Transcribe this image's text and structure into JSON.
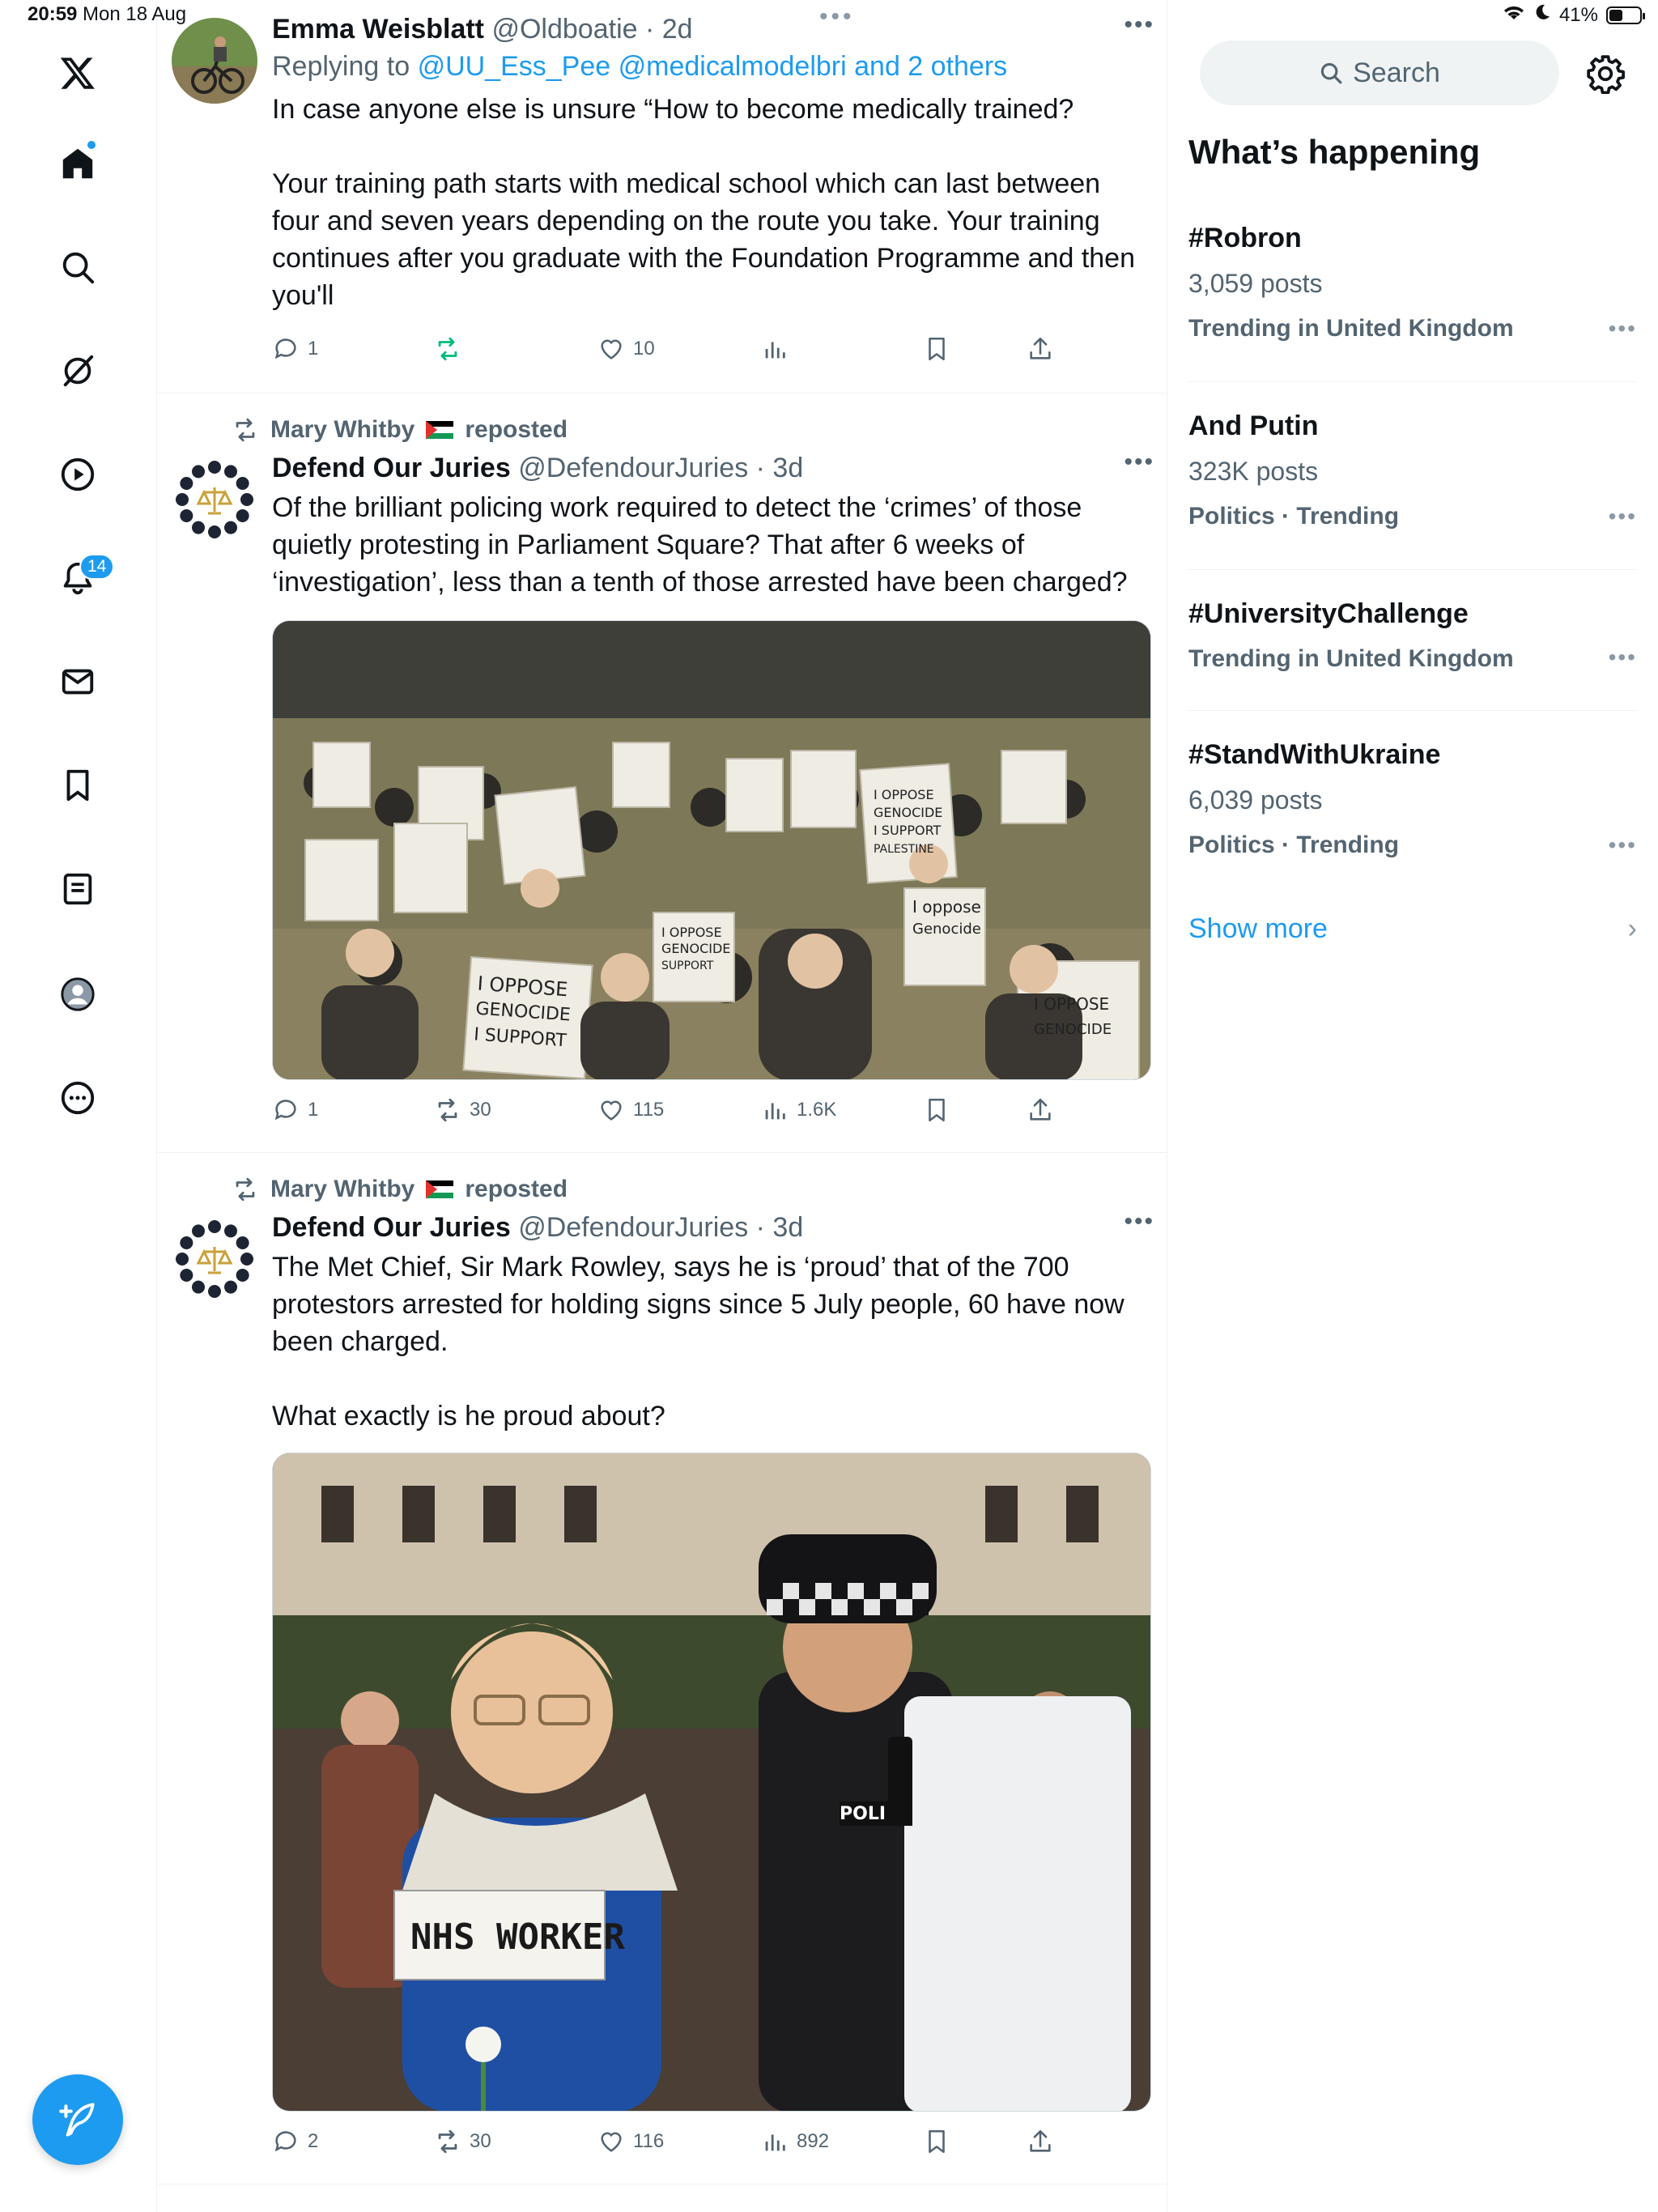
{
  "status_bar": {
    "time": "20:59",
    "date": "Mon 18 Aug",
    "battery": "41%",
    "battery_level": 0.41
  },
  "nav": {
    "notifications_badge": "14",
    "items": [
      "x-logo-icon",
      "home-icon",
      "search-icon",
      "grok-icon",
      "video-icon",
      "notifications-icon",
      "messages-icon",
      "bookmarks-icon",
      "lists-icon",
      "profile-icon",
      "more-icon"
    ]
  },
  "tweets": [
    {
      "name": "Emma Weisblatt",
      "handle": "@Oldboatie",
      "time": "2d",
      "replying_label": "Replying to",
      "replying_to": "@UU_Ess_Pee @medicalmodelbri and 2 others",
      "text": "In case anyone else is unsure “How to become medically trained?\n\nYour training path starts with medical school which can last between four and seven years depending on the route you take. Your training continues after you graduate with the Foundation Programme and then you'll",
      "replies": "1",
      "reposts": "",
      "likes": "10",
      "views": "",
      "colors": {
        "repost_active": "#00ba7c"
      }
    },
    {
      "reposted_by": "Mary Whitby",
      "reposted_label": "reposted",
      "name": "Defend Our Juries",
      "handle": "@DefendourJuries",
      "time": "3d",
      "text": "Of the brilliant policing work required to detect the ‘crimes’ of those quietly protesting in Parliament Square? That after 6 weeks of ‘investigation’, less than a tenth of those arrested have been charged?",
      "media_signs": [
        "I OPPOSE GENOCIDE I SUPPORT PALESTINE ACTION",
        "I oppose Genocide",
        "I OPPOSE GENOCIDE I SUPPORT PALESTINE",
        "I OPPOSE GENOCIDE SUPPORT PALESTINE ACTION"
      ],
      "replies": "1",
      "reposts": "30",
      "likes": "115",
      "views": "1.6K"
    },
    {
      "reposted_by": "Mary Whitby",
      "reposted_label": "reposted",
      "name": "Defend Our Juries",
      "handle": "@DefendourJuries",
      "time": "3d",
      "text": "The Met Chief, Sir Mark Rowley, says he is ‘proud’ that of the 700 protestors arrested for holding signs since 5 July people, 60 have now been charged.\n\nWhat exactly is he proud about?",
      "media_label": "NHS WORKER",
      "replies": "2",
      "reposts": "30",
      "likes": "116",
      "views": "892"
    }
  ],
  "sidebar": {
    "search_placeholder": "Search",
    "title": "What’s happening",
    "trends": [
      {
        "tag": "#Robron",
        "posts": "3,059 posts",
        "context": "Trending in United Kingdom"
      },
      {
        "tag": "And Putin",
        "posts": "323K posts",
        "context": "Politics · Trending"
      },
      {
        "tag": "#UniversityChallenge",
        "posts": "",
        "context": "Trending in United Kingdom"
      },
      {
        "tag": "#StandWithUkraine",
        "posts": "6,039 posts",
        "context": "Politics · Trending"
      }
    ],
    "show_more": "Show more",
    "accent": "#1d9bf0"
  }
}
